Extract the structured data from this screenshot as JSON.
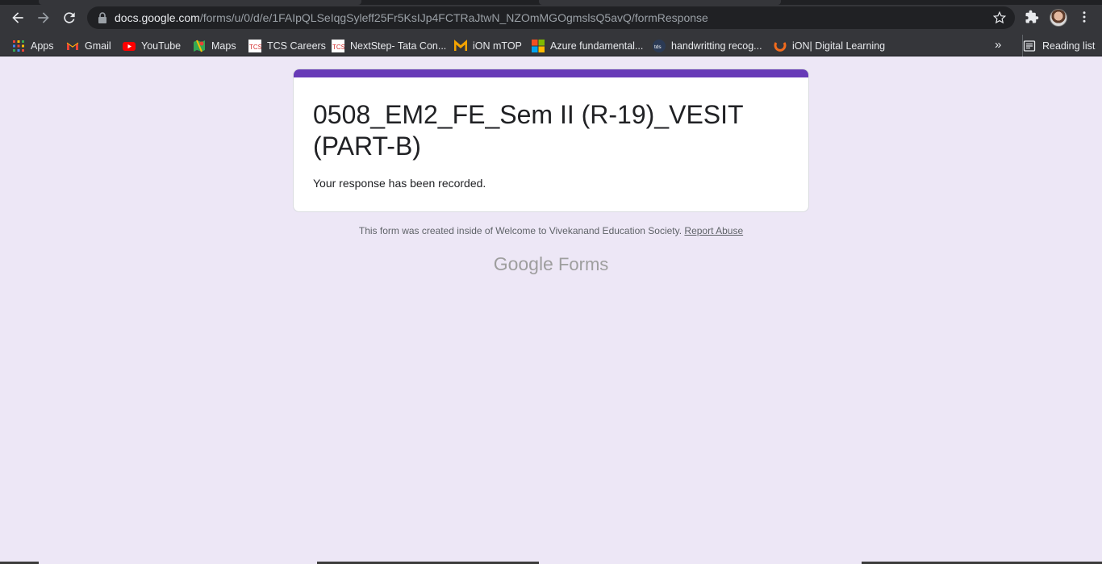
{
  "browser": {
    "url_host": "docs.google.com",
    "url_path": "/forms/u/0/d/e/1FAIpQLSeIqgSyleff25Fr5KsIJp4FCTRaJtwN_NZOmMGOgmslsQ5avQ/formResponse",
    "bookmarks": [
      {
        "label": "Apps",
        "icon": "apps-grid-icon"
      },
      {
        "label": "Gmail",
        "icon": "gmail-icon"
      },
      {
        "label": "YouTube",
        "icon": "youtube-icon"
      },
      {
        "label": "Maps",
        "icon": "maps-icon"
      },
      {
        "label": "TCS Careers",
        "icon": "tcs-icon"
      },
      {
        "label": "NextStep- Tata Con...",
        "icon": "tcs-icon"
      },
      {
        "label": "iON mTOP",
        "icon": "ion-m-icon"
      },
      {
        "label": "Azure fundamental...",
        "icon": "microsoft-icon"
      },
      {
        "label": "handwritting recog...",
        "icon": "tds-icon"
      },
      {
        "label": "iON| Digital Learning",
        "icon": "ion-icon"
      }
    ],
    "more_label": "»",
    "reading_list_label": "Reading list"
  },
  "form": {
    "title": "0508_EM2_FE_Sem II (R-19)_VESIT (PART-B)",
    "message": "Your response has been recorded.",
    "accent_color": "#673ab7",
    "background_color": "#ede7f6"
  },
  "footer": {
    "note": "This form was created inside of Welcome to Vivekanand Education Society.",
    "report_label": "Report Abuse",
    "brand_google": "Google",
    "brand_forms": "Forms"
  }
}
